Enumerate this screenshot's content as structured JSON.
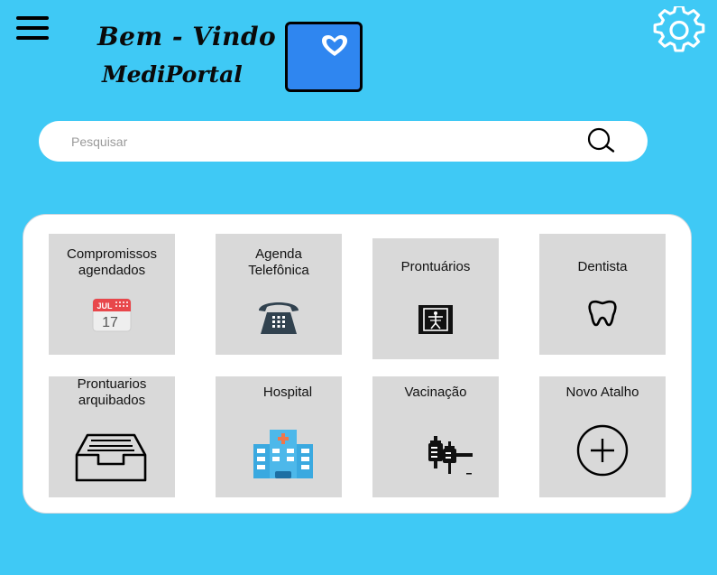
{
  "header": {
    "title_line1": "Bem - Vindo",
    "title_line2": "MediPortal"
  },
  "icons": {
    "menu": "hamburger-menu-icon",
    "logo": "heart-icon",
    "settings": "gear-icon",
    "search": "magnifier-icon"
  },
  "search": {
    "placeholder": "Pesquisar",
    "value": ""
  },
  "tiles": [
    {
      "label": "Compromissos\nagendados",
      "icon": "calendar-icon",
      "icon_text_month": "JUL",
      "icon_text_day": "17"
    },
    {
      "label": "Agenda\nTelefônica",
      "icon": "telephone-icon"
    },
    {
      "label": "Prontuários",
      "icon": "medical-record-icon"
    },
    {
      "label": "Dentista",
      "icon": "tooth-icon"
    },
    {
      "label": "Prontuarios\narquibados",
      "icon": "inbox-tray-icon"
    },
    {
      "label": "Hospital",
      "icon": "hospital-icon"
    },
    {
      "label": "Vacinação",
      "icon": "syringe-icon"
    },
    {
      "label": "Novo Atalho",
      "icon": "add-circle-icon"
    }
  ],
  "colors": {
    "background": "#3fc9f5",
    "logo_fill": "#2f86f0",
    "tile": "#d9d9d9",
    "calendar_red": "#e8474b",
    "hospital_blue": "#3aa9e0",
    "hospital_cross": "#f0764a"
  }
}
